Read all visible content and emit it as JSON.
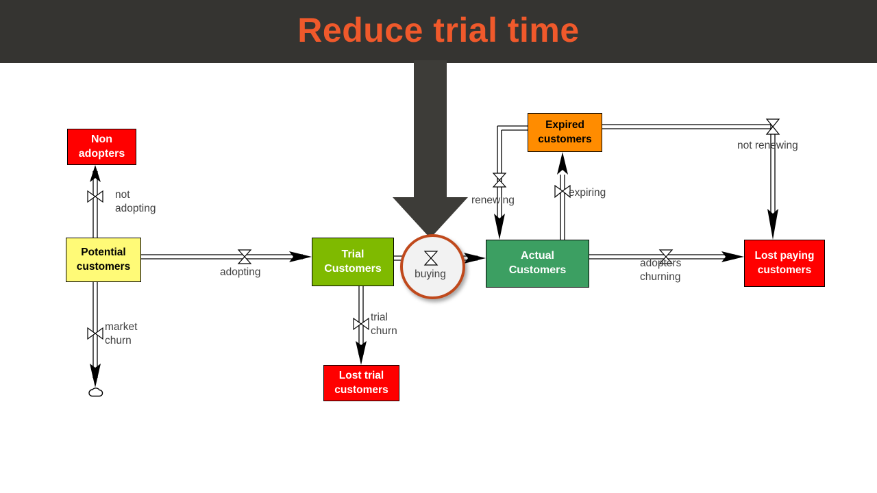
{
  "title": {
    "text": "Reduce trial time",
    "color": "#F0592B",
    "bar_color": "#353431"
  },
  "diagram": {
    "type": "stock-and-flow",
    "stocks": [
      {
        "id": "non-adopters",
        "line1": "Non",
        "line2": "adopters",
        "color": "#FF0000",
        "text_color": "#FFFFFF"
      },
      {
        "id": "potential",
        "line1": "Potential",
        "line2": "customers",
        "color": "#FFFA77",
        "text_color": "#000000"
      },
      {
        "id": "trial",
        "line1": "Trial",
        "line2": "Customers",
        "color": "#7FBA00",
        "text_color": "#FFFFFF"
      },
      {
        "id": "lost-trial",
        "line1": "Lost trial",
        "line2": "customers",
        "color": "#FF0000",
        "text_color": "#FFFFFF"
      },
      {
        "id": "expired",
        "line1": "Expired",
        "line2": "customers",
        "color": "#FF8C00",
        "text_color": "#000000"
      },
      {
        "id": "actual",
        "line1": "Actual",
        "line2": "Customers",
        "color": "#3C9F62",
        "text_color": "#FFFFFF"
      },
      {
        "id": "lost-paying",
        "line1": "Lost paying",
        "line2": "customers",
        "color": "#FF0000",
        "text_color": "#FFFFFF"
      }
    ],
    "flows": [
      {
        "id": "not-adopting",
        "line1": "not",
        "line2": "adopting",
        "from": "potential",
        "to": "non-adopters"
      },
      {
        "id": "market-churn",
        "line1": "market",
        "line2": "churn",
        "from": "potential",
        "to": "cloud-sink"
      },
      {
        "id": "adopting",
        "line1": "adopting",
        "line2": "",
        "from": "potential",
        "to": "trial"
      },
      {
        "id": "trial-churn",
        "line1": "trial",
        "line2": "churn",
        "from": "trial",
        "to": "lost-trial"
      },
      {
        "id": "buying",
        "line1": "buying",
        "line2": "",
        "from": "trial",
        "to": "actual",
        "highlighted": true
      },
      {
        "id": "renewing",
        "line1": "renewing",
        "line2": "",
        "from": "expired",
        "to": "actual"
      },
      {
        "id": "expiring",
        "line1": "expiring",
        "line2": "",
        "from": "actual",
        "to": "expired"
      },
      {
        "id": "not-renewing",
        "line1": "not renewing",
        "line2": "",
        "from": "expired",
        "to": "lost-paying"
      },
      {
        "id": "adopters-churning",
        "line1": "adopters",
        "line2": "churning",
        "from": "actual",
        "to": "lost-paying"
      }
    ],
    "highlight": {
      "circle_stroke": "#C0491C",
      "circle_fill": "#F2F2F2",
      "pointer_arrow_color": "#3D3C38"
    },
    "label_color": "#404040"
  }
}
